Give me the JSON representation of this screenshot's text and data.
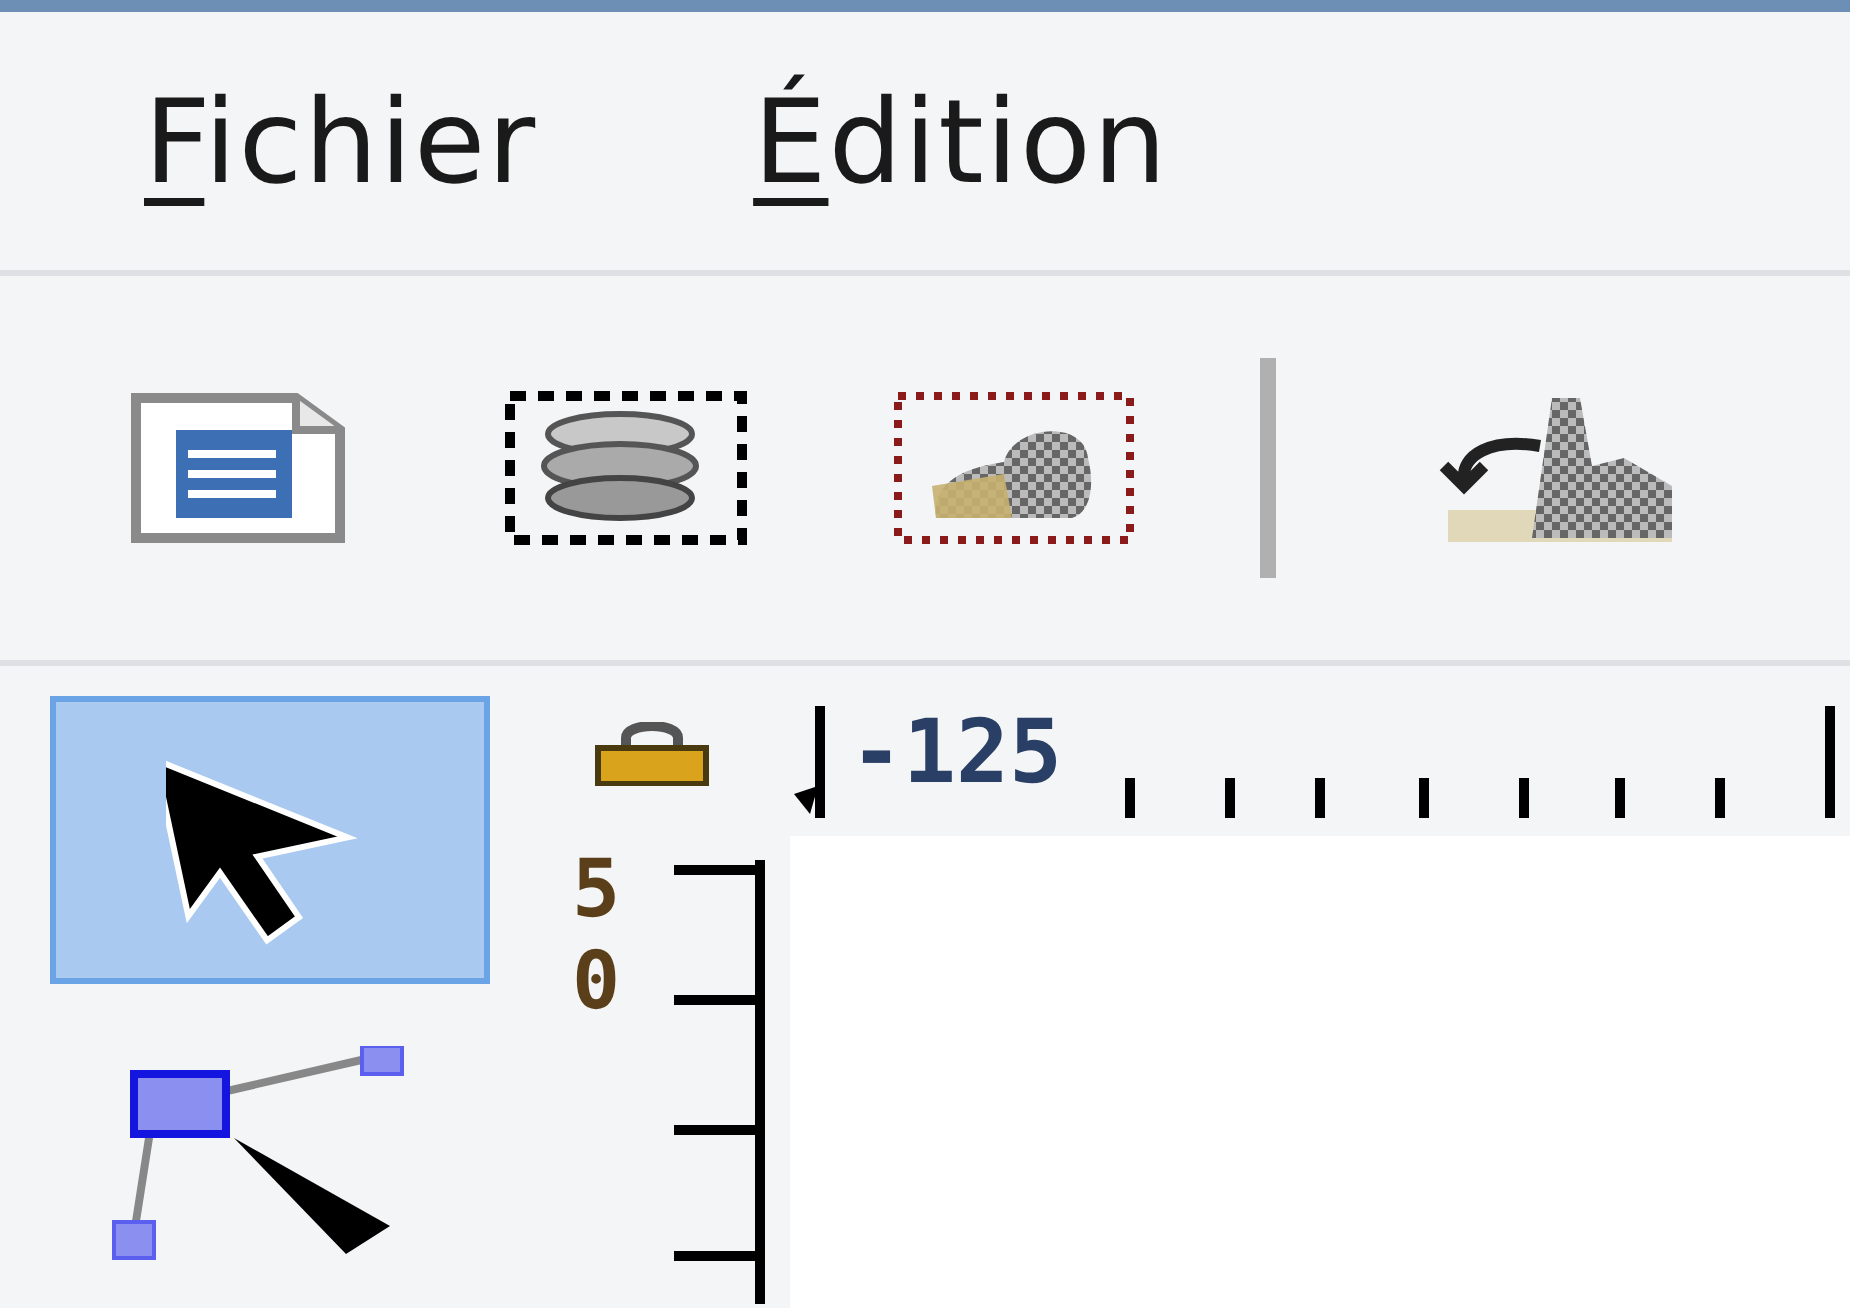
{
  "menu": [
    {
      "label": "Fichier"
    },
    {
      "label": "Édition"
    }
  ],
  "tools": [
    {
      "kind": "selector",
      "selected": true
    },
    {
      "kind": "node",
      "selected": false
    }
  ],
  "rulers": {
    "horizontal_label": "-125",
    "vertical_label": "50"
  }
}
